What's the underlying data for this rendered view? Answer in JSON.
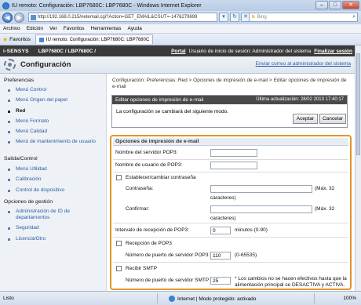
{
  "window": {
    "title": "IU remoto: Configuración: LBP7680C: LBP7680C - Windows Internet Explorer",
    "url": "http://192.168.0.215/netemail.cgi?Action=GET_EMAIL&CSUT=-1476279699",
    "search_placeholder": "Bing",
    "menu": [
      "Archivo",
      "Edición",
      "Ver",
      "Favoritos",
      "Herramientas",
      "Ayuda"
    ],
    "favorites_label": "Favoritos",
    "tab_label": "IU remoto: Configuración: LBP7680C: LBP7680C"
  },
  "topbar": {
    "brand": "i-SENSYS",
    "model": "LBP7680C / LBP7680C /",
    "portal": "Portal",
    "user": "Usuario de inicio de sesión: Administrador del sistema",
    "logout": "Finalizar sesión"
  },
  "header": {
    "title": "Configuración",
    "mail_admin": "Enviar correo al administrador del sistema"
  },
  "sidebar": {
    "preferencias": "Preferencias",
    "items_pref": [
      "Menú Control",
      "Menú Origen del papel",
      "Red",
      "Menú Formato",
      "Menú Calidad",
      "Menú de mantenimiento de usuario"
    ],
    "salida": "Salida/Control",
    "items_salida": [
      "Menú Utilidad",
      "Calibración",
      "Control de dispositivo"
    ],
    "gestion": "Opciones de gestión",
    "items_gestion": [
      "Administración de ID de departamentos",
      "Seguridad",
      "Licencia/Otro"
    ]
  },
  "main": {
    "breadcrumb": "Configuración: Preferencias: Red > Opciones de impresión de e-mail > Editar opciones de impresión de e-mail",
    "edit_title": "Editar opciones de impresión de e-mail",
    "last_update": "Última actualización: 28/02 2013 17:40:17",
    "message": "La configuración se cambiará del siguiente modo.",
    "accept": "Aceptar",
    "cancel": "Cancelar"
  },
  "options": {
    "header": "Opciones de impresión de e-mail",
    "pop3_server": "Nombre del servidor POP3:",
    "pop3_user": "Nombre de usuario de POP3:",
    "set_password": "Establecer/cambiar contraseña",
    "password": "Contraseña:",
    "password_hint": "(Máx. 32",
    "password_hint2": "caracteres)",
    "confirm": "Confirmar:",
    "confirm_hint": "(Máx. 32",
    "confirm_hint2": "caracteres)",
    "interval": "Intervalo de recepción de POP3:",
    "interval_value": "0",
    "interval_unit": "minutos (0-90)",
    "receive_pop3": "Recepción de POP3",
    "pop3_port": "Número de puerto de servidor POP3:",
    "pop3_port_value": "110",
    "pop3_port_range": "(0-65535)",
    "receive_smtp": "Recibir SMTP",
    "smtp_port": "Número de puerto de servidor SMTP:",
    "smtp_port_value": "25",
    "note": "* Los cambios no se hacen efectivos hasta que la alimentación principal se DESACTIVA y ACTIVA."
  },
  "status": {
    "left": "Listo",
    "zone": "Internet | Modo protegido: activado",
    "zoom": "100%"
  }
}
